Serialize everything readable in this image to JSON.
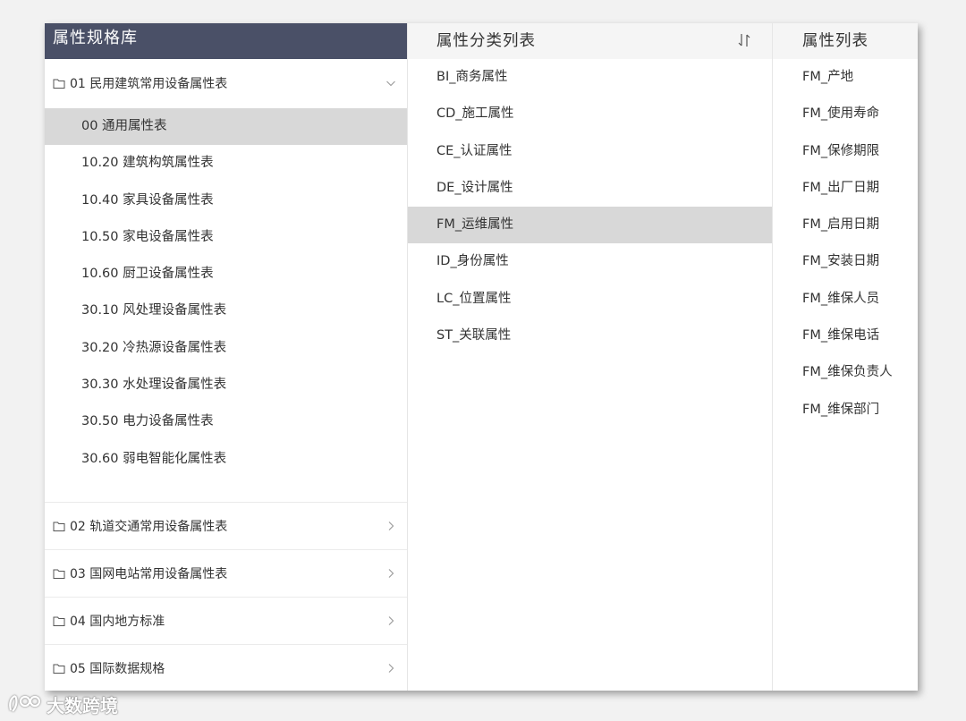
{
  "left_panel": {
    "title": "属性规格库",
    "groups": [
      {
        "label": "01 民用建筑常用设备属性表",
        "expanded": true,
        "items": [
          {
            "label": "00 通用属性表",
            "selected": true
          },
          {
            "label": "10.20 建筑构筑属性表"
          },
          {
            "label": "10.40 家具设备属性表"
          },
          {
            "label": "10.50 家电设备属性表"
          },
          {
            "label": "10.60 厨卫设备属性表"
          },
          {
            "label": "30.10 风处理设备属性表"
          },
          {
            "label": "30.20 冷热源设备属性表"
          },
          {
            "label": "30.30 水处理设备属性表"
          },
          {
            "label": "30.50 电力设备属性表"
          },
          {
            "label": "30.60 弱电智能化属性表"
          }
        ]
      },
      {
        "label": "02 轨道交通常用设备属性表",
        "expanded": false
      },
      {
        "label": "03 国网电站常用设备属性表",
        "expanded": false
      },
      {
        "label": "04 国内地方标准",
        "expanded": false
      },
      {
        "label": "05 国际数据规格",
        "expanded": false
      }
    ]
  },
  "middle_panel": {
    "title": "属性分类列表",
    "items": [
      {
        "label": "BI_商务属性"
      },
      {
        "label": "CD_施工属性"
      },
      {
        "label": "CE_认证属性"
      },
      {
        "label": "DE_设计属性"
      },
      {
        "label": "FM_运维属性",
        "selected": true
      },
      {
        "label": "ID_身份属性"
      },
      {
        "label": "LC_位置属性"
      },
      {
        "label": "ST_关联属性"
      }
    ]
  },
  "right_panel": {
    "title": "属性列表",
    "items": [
      {
        "label": "FM_产地"
      },
      {
        "label": "FM_使用寿命"
      },
      {
        "label": "FM_保修期限"
      },
      {
        "label": "FM_出厂日期"
      },
      {
        "label": "FM_启用日期"
      },
      {
        "label": "FM_安装日期"
      },
      {
        "label": "FM_维保人员"
      },
      {
        "label": "FM_维保电话"
      },
      {
        "label": "FM_维保负责人"
      },
      {
        "label": "FM_维保部门"
      }
    ]
  },
  "watermark": {
    "text": "大数跨境"
  },
  "colors": {
    "header_dark": "#4a5067",
    "header_light": "#f5f5f5",
    "selected_row": "#d8d8d8",
    "background": "#f2f2f2"
  },
  "icons": {
    "group": "folder-icon",
    "expanded": "chevron-down-icon",
    "collapsed": "chevron-right-icon",
    "sort": "sort-icon"
  }
}
